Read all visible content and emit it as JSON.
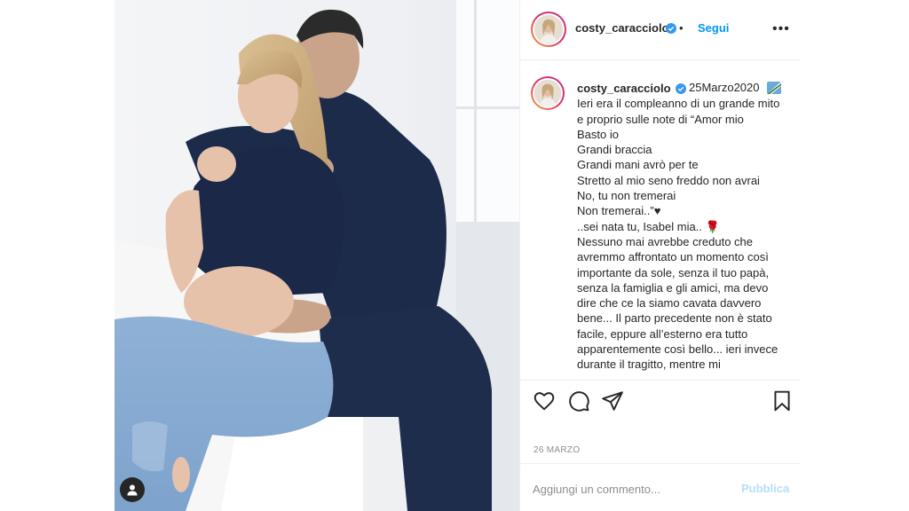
{
  "post": {
    "username": "costy_caracciolo",
    "follow_label": "Segui",
    "separator": "•",
    "more_label": "•••",
    "caption_date": "25Marzo2020",
    "caption_lines": [
      "Ieri era il compleanno di un grande mito",
      "e proprio sulle note di “Amor mio",
      "Basto io",
      "Grandi braccia",
      "Grandi mani avrò per te",
      "Stretto al mio seno freddo non avrai",
      "No, tu non tremerai",
      "Non tremerai..”♥",
      "..sei nata tu, Isabel mia.. 🌹",
      "Nessuno mai avrebbe creduto che",
      "avremmo affrontato un momento così",
      "importante da sole, senza il tuo papà,",
      "senza la famiglia e gli amici, ma devo",
      "dire che ce la siamo cavata davvero",
      "bene... Il parto precedente non è stato",
      "facile, eppure all’esterno era tutto",
      "apparentemente così bello... ieri invece",
      "durante il tragitto, mentre mi"
    ],
    "post_date": "26 MARZO",
    "comment_placeholder": "Aggiungi un commento...",
    "publish_label": "Pubblica"
  },
  "icons": {
    "verified": "verified-badge-icon",
    "like": "heart-icon",
    "comment": "comment-bubble-icon",
    "share": "paper-plane-icon",
    "save": "bookmark-icon",
    "tagged_user": "user-tag-icon",
    "flag": "flag-emoji-icon"
  },
  "colors": {
    "accent": "#0095f6",
    "publish_disabled": "#b2dffc",
    "text": "#262626",
    "muted": "#8e8e8e",
    "divider": "#efefef"
  }
}
